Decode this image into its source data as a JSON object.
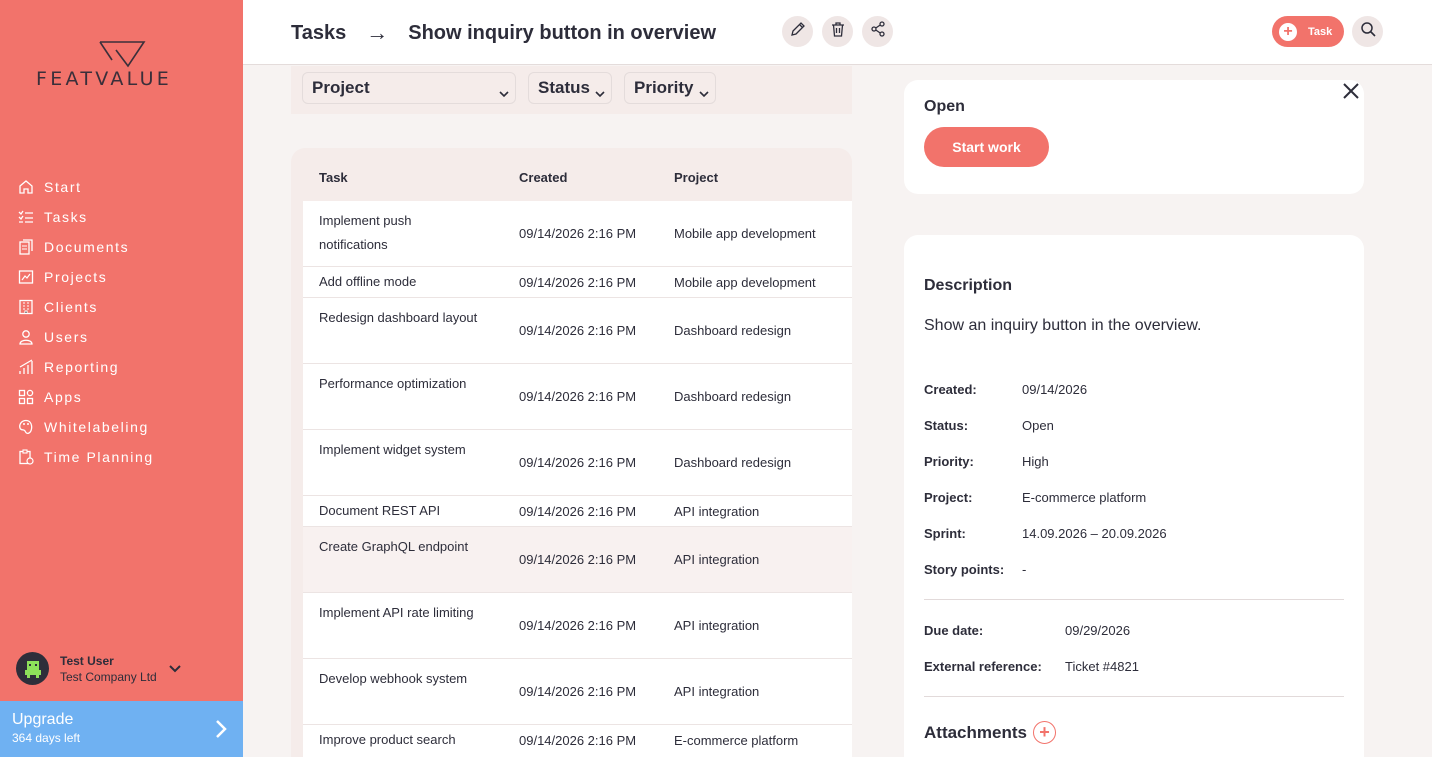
{
  "brand": {
    "name": "FEATVALUE",
    "accent": "#f2736b",
    "upgrade_color": "#6fb1f2"
  },
  "sidebar": {
    "items": [
      {
        "label": "Start",
        "icon": "home-icon"
      },
      {
        "label": "Tasks",
        "icon": "checklist-icon"
      },
      {
        "label": "Documents",
        "icon": "documents-icon"
      },
      {
        "label": "Projects",
        "icon": "projects-icon"
      },
      {
        "label": "Clients",
        "icon": "building-icon"
      },
      {
        "label": "Users",
        "icon": "user-icon"
      },
      {
        "label": "Reporting",
        "icon": "chart-icon"
      },
      {
        "label": "Apps",
        "icon": "apps-icon"
      },
      {
        "label": "Whitelabeling",
        "icon": "palette-icon"
      },
      {
        "label": "Time Planning",
        "icon": "clipboard-icon"
      }
    ],
    "user": {
      "name": "Test User",
      "company": "Test Company Ltd"
    },
    "upgrade": {
      "title": "Upgrade",
      "subtitle": "364 days left"
    }
  },
  "header": {
    "crumb_root": "Tasks",
    "separator": "→",
    "title": "Show inquiry button in overview",
    "add_task_label": "Task"
  },
  "filters": {
    "project": "Project",
    "status": "Status",
    "priority": "Priority"
  },
  "table": {
    "columns": [
      "Task",
      "Created",
      "Project"
    ],
    "rows": [
      {
        "task": "Implement push notifications",
        "created": "09/14/2026 2:16 PM",
        "project": "Mobile app development"
      },
      {
        "task": "Add offline mode",
        "created": "09/14/2026 2:16 PM",
        "project": "Mobile app development"
      },
      {
        "task": "Redesign dashboard layout",
        "created": "09/14/2026 2:16 PM",
        "project": "Dashboard redesign"
      },
      {
        "task": "Performance optimization",
        "created": "09/14/2026 2:16 PM",
        "project": "Dashboard redesign"
      },
      {
        "task": "Implement widget system",
        "created": "09/14/2026 2:16 PM",
        "project": "Dashboard redesign"
      },
      {
        "task": "Document REST API",
        "created": "09/14/2026 2:16 PM",
        "project": "API integration"
      },
      {
        "task": "Create GraphQL endpoint",
        "created": "09/14/2026 2:16 PM",
        "project": "API integration"
      },
      {
        "task": "Implement API rate limiting",
        "created": "09/14/2026 2:16 PM",
        "project": "API integration"
      },
      {
        "task": "Develop webhook system",
        "created": "09/14/2026 2:16 PM",
        "project": "API integration"
      },
      {
        "task": "Improve product search",
        "created": "09/14/2026 2:16 PM",
        "project": "E-commerce platform"
      }
    ]
  },
  "detail": {
    "status_title": "Open",
    "start_button": "Start work",
    "description_title": "Description",
    "description": "Show an inquiry button in the overview.",
    "fields": [
      {
        "key": "Created:",
        "value": "09/14/2026"
      },
      {
        "key": "Status:",
        "value": "Open"
      },
      {
        "key": "Priority:",
        "value": "High"
      },
      {
        "key": "Project:",
        "value": "E-commerce platform"
      },
      {
        "key": "Sprint:",
        "value": "14.09.2026 – 20.09.2026"
      },
      {
        "key": "Story points:",
        "value": "-"
      }
    ],
    "fields2": [
      {
        "key": "Due date:",
        "value": "09/29/2026"
      },
      {
        "key": "External reference:",
        "value": "Ticket #4821"
      }
    ],
    "attachments_title": "Attachments"
  }
}
